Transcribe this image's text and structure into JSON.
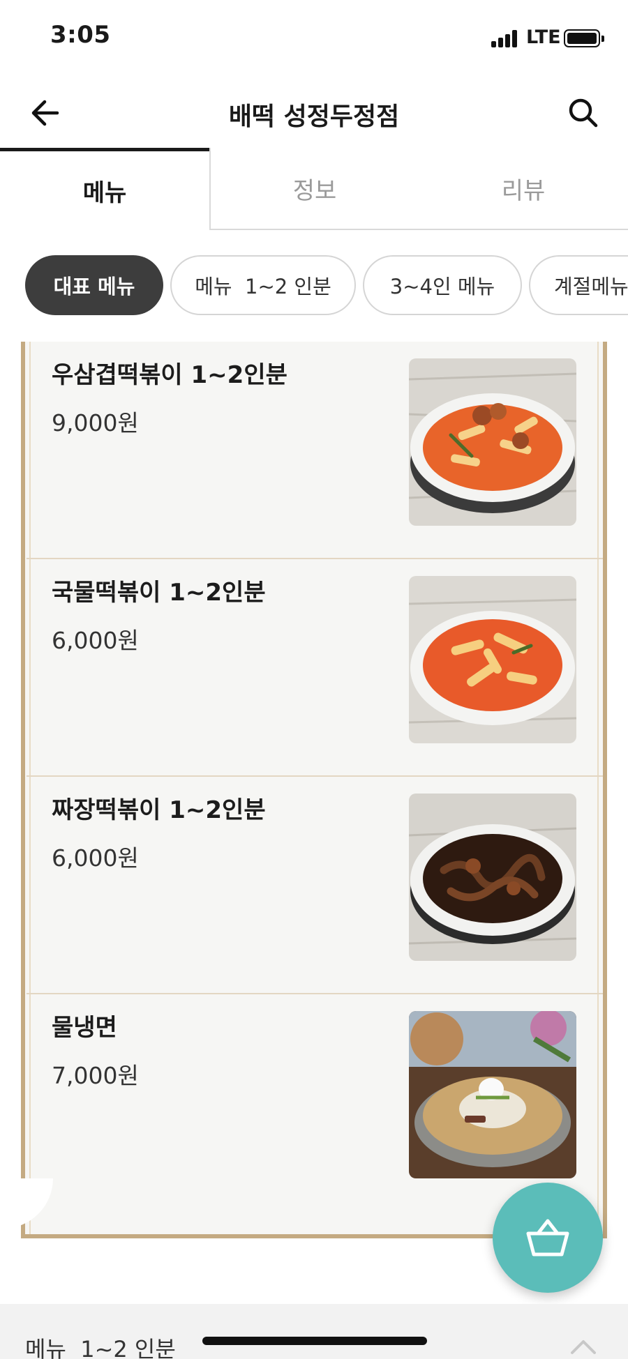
{
  "status_bar": {
    "time": "3:05",
    "network": "LTE"
  },
  "header": {
    "title": "배떡 성정두정점",
    "back_icon": "arrow-left-icon",
    "search_icon": "search-icon"
  },
  "tabs": [
    {
      "label": "메뉴",
      "active": true
    },
    {
      "label": "정보",
      "active": false
    },
    {
      "label": "리뷰",
      "active": false
    }
  ],
  "categories": [
    {
      "label": "대표 메뉴",
      "selected": true
    },
    {
      "label": "메뉴  1~2 인분",
      "selected": false
    },
    {
      "label": "3~4인 메뉴",
      "selected": false
    },
    {
      "label": "계절메뉴",
      "selected": false
    }
  ],
  "menu_items": [
    {
      "name": "우삼겹떡볶이 1~2인분",
      "price": "9,000원",
      "image": "tteokbokki-beef-photo"
    },
    {
      "name": "국물떡볶이 1~2인분",
      "price": "6,000원",
      "image": "soup-tteokbokki-photo"
    },
    {
      "name": "짜장떡볶이 1~2인분",
      "price": "6,000원",
      "image": "jjajang-tteokbokki-photo"
    },
    {
      "name": "물냉면",
      "price": "7,000원",
      "image": "mul-naengmyeon-photo"
    }
  ],
  "cart": {
    "icon": "basket-icon",
    "color": "#5bbdb9"
  },
  "bottom_bar": {
    "label": "메뉴  1~2 인분",
    "icon": "chevron-up-icon"
  },
  "colors": {
    "frame": "#c4aa82",
    "chip_selected": "#3d3d3d",
    "accent": "#5bbdb9"
  }
}
